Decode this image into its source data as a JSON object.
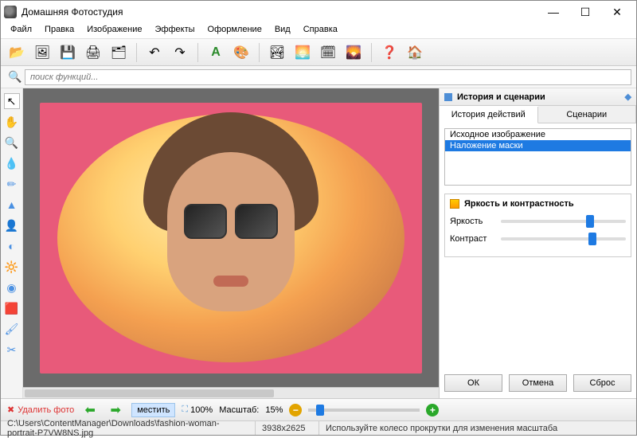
{
  "window": {
    "title": "Домашняя Фотостудия"
  },
  "menu": [
    "Файл",
    "Правка",
    "Изображение",
    "Эффекты",
    "Оформление",
    "Вид",
    "Справка"
  ],
  "toolbar_icons": [
    "📂",
    "🖼",
    "💾",
    "🖨",
    "🗂",
    "—",
    "↶",
    "↷",
    "—",
    "A",
    "🎨",
    "—",
    "🏞",
    "🌅",
    "🗓",
    "🌄",
    "—",
    "❓",
    "🏠"
  ],
  "search": {
    "placeholder": "поиск функций..."
  },
  "side_tools": [
    "↖",
    "✋",
    "🔍",
    "💧",
    "✏",
    "▲",
    "👤",
    "◐",
    "🔆",
    "◉",
    "🟥",
    "🖌",
    "✂"
  ],
  "right": {
    "panel_title": "История и сценарии",
    "tabs": [
      "История действий",
      "Сценарии"
    ],
    "history": [
      {
        "label": "Исходное изображение",
        "sel": false
      },
      {
        "label": "Наложение маски",
        "sel": true
      }
    ],
    "section_title": "Яркость и контрастность",
    "slider1": "Яркость",
    "slider2": "Контраст",
    "buttons": [
      "ОК",
      "Отмена",
      "Сброс"
    ]
  },
  "bottom": {
    "delete": "Удалить фото",
    "fit": "местить",
    "zoom100_label": "100%",
    "scale_label": "Масштаб:",
    "scale_value": "15%"
  },
  "status": {
    "path": "C:\\Users\\ContentManager\\Downloads\\fashion-woman-portrait-P7VW8NS.jpg",
    "dims": "3938x2625",
    "hint": "Используйте колесо прокрутки для изменения масштаба"
  }
}
